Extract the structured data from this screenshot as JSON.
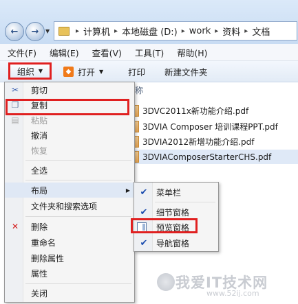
{
  "address": {
    "crumbs": [
      "计算机",
      "本地磁盘 (D:)",
      "work",
      "资料",
      "文档"
    ]
  },
  "menubar": {
    "items": [
      "文件(F)",
      "编辑(E)",
      "查看(V)",
      "工具(T)",
      "帮助(H)"
    ]
  },
  "toolbar": {
    "organize": "组织",
    "open": "打开",
    "print": "打印",
    "new_folder": "新建文件夹"
  },
  "file_list": {
    "column_header_partial": "称",
    "files": [
      "3DVC2011x新功能介绍.pdf",
      "3DVIA Composer 培训课程PPT.pdf",
      "3DVIA2012新增功能介绍.pdf",
      "3DVIAComposerStarterCHS.pdf"
    ]
  },
  "organize_menu": {
    "items": [
      {
        "label": "剪切",
        "icon": "scissors-icon",
        "disabled": false
      },
      {
        "label": "复制",
        "icon": "copy-icon",
        "disabled": false
      },
      {
        "label": "粘贴",
        "icon": "paste-icon",
        "disabled": true
      },
      {
        "label": "撤消",
        "icon": "",
        "disabled": false
      },
      {
        "label": "恢复",
        "icon": "",
        "disabled": true
      },
      {
        "label": "全选",
        "icon": "",
        "disabled": false
      },
      {
        "label": "布局",
        "icon": "",
        "disabled": false
      },
      {
        "label": "文件夹和搜索选项",
        "icon": "",
        "disabled": false
      },
      {
        "label": "删除",
        "icon": "delete-x-icon",
        "disabled": false
      },
      {
        "label": "重命名",
        "icon": "",
        "disabled": false
      },
      {
        "label": "删除属性",
        "icon": "",
        "disabled": false
      },
      {
        "label": "属性",
        "icon": "",
        "disabled": false
      },
      {
        "label": "关闭",
        "icon": "",
        "disabled": false
      }
    ]
  },
  "layout_submenu": {
    "items": [
      {
        "label": "菜单栏",
        "checked": true
      },
      {
        "label": "细节窗格",
        "checked": true
      },
      {
        "label": "预览窗格",
        "checked": false
      },
      {
        "label": "导航窗格",
        "checked": true
      }
    ]
  },
  "watermark": {
    "text": "我爱IT技术网",
    "url": "www.52ij.com"
  },
  "colors": {
    "highlight_box": "#e02020",
    "check": "#1e4fb0"
  }
}
